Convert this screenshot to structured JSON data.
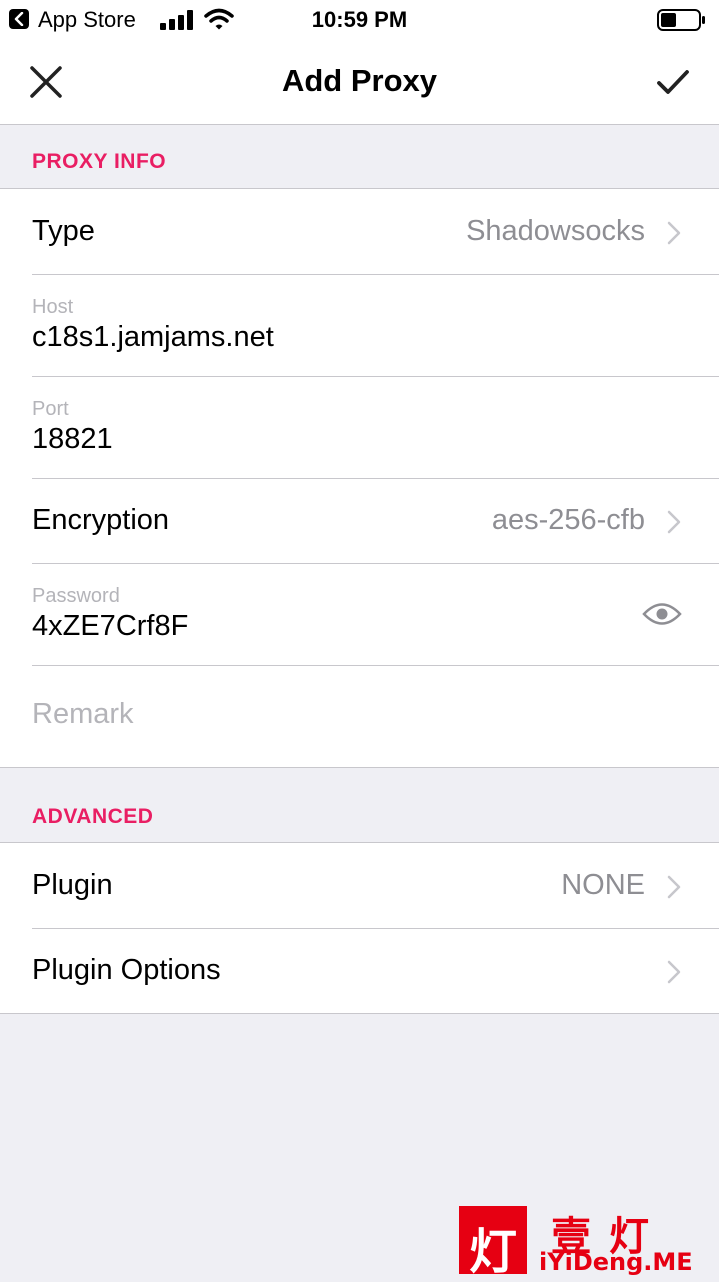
{
  "status_bar": {
    "back_app": "App Store",
    "time": "10:59 PM"
  },
  "nav": {
    "title": "Add Proxy",
    "close_icon": "close-icon",
    "done_icon": "checkmark-icon"
  },
  "sections": {
    "proxy_info": {
      "header": "PROXY INFO",
      "type": {
        "label": "Type",
        "value": "Shadowsocks"
      },
      "host": {
        "label": "Host",
        "value": "c18s1.jamjams.net"
      },
      "port": {
        "label": "Port",
        "value": "18821"
      },
      "encryption": {
        "label": "Encryption",
        "value": "aes-256-cfb"
      },
      "password": {
        "label": "Password",
        "value": "4xZE7Crf8F"
      },
      "remark": {
        "placeholder": "Remark"
      }
    },
    "advanced": {
      "header": "ADVANCED",
      "plugin": {
        "label": "Plugin",
        "value": "NONE"
      },
      "plugin_options": {
        "label": "Plugin Options"
      }
    }
  },
  "watermark": {
    "logo_char": "灯",
    "chinese": "壹灯",
    "site": "iYiDeng.ME"
  },
  "colors": {
    "accent": "#e91e63",
    "background": "#efeff4",
    "secondary_text": "#8e8e93",
    "watermark": "#e60012"
  }
}
